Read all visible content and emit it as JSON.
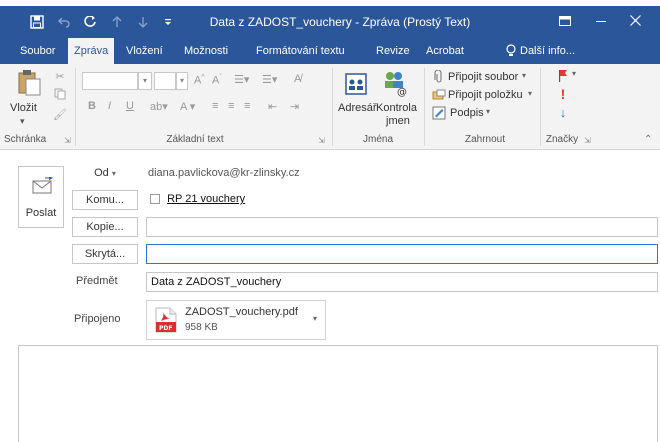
{
  "window": {
    "title": "Data z ZADOST_vouchery - Zpráva (Prostý Text)",
    "icons": [
      "save-icon",
      "undo-icon",
      "redo-icon",
      "up-icon",
      "down-icon",
      "customize-icon"
    ]
  },
  "tabs": [
    {
      "label": "Soubor",
      "active": false
    },
    {
      "label": "Zpráva",
      "active": true
    },
    {
      "label": "Vložení",
      "active": false
    },
    {
      "label": "Možnosti",
      "active": false
    },
    {
      "label": "Formátování textu",
      "active": false
    },
    {
      "label": "Revize",
      "active": false
    },
    {
      "label": "Acrobat",
      "active": false
    },
    {
      "label": "Další info...",
      "active": false
    }
  ],
  "ribbon": {
    "clipboard": {
      "paste_label": "Vložit",
      "group_label": "Schránka"
    },
    "basic_text": {
      "group_label": "Základní text"
    },
    "names": {
      "address_book_label": "Adresář",
      "check_names_line1": "Kontrola",
      "check_names_line2": "jmen",
      "group_label": "Jména"
    },
    "include": {
      "attach_file": "Připojit soubor",
      "attach_item": "Připojit položku",
      "signature": "Podpis",
      "group_label": "Zahrnout"
    },
    "tags": {
      "group_label": "Značky"
    }
  },
  "form": {
    "send_label": "Poslat",
    "from_label": "Od",
    "from_value": "diana.pavlickova@kr-zlinsky.cz",
    "to_label": "Komu...",
    "to_value": "RP 21 vouchery",
    "cc_label": "Kopie...",
    "bcc_label": "Skrytá...",
    "subject_label": "Předmět",
    "subject_value": "Data z ZADOST_vouchery",
    "attached_label": "Připojeno",
    "attachment": {
      "name": "ZADOST_vouchery.pdf",
      "size": "958 KB"
    }
  },
  "colors": {
    "accent": "#2b579a",
    "focus": "#2b78d0",
    "pdf_red": "#d6322b"
  }
}
